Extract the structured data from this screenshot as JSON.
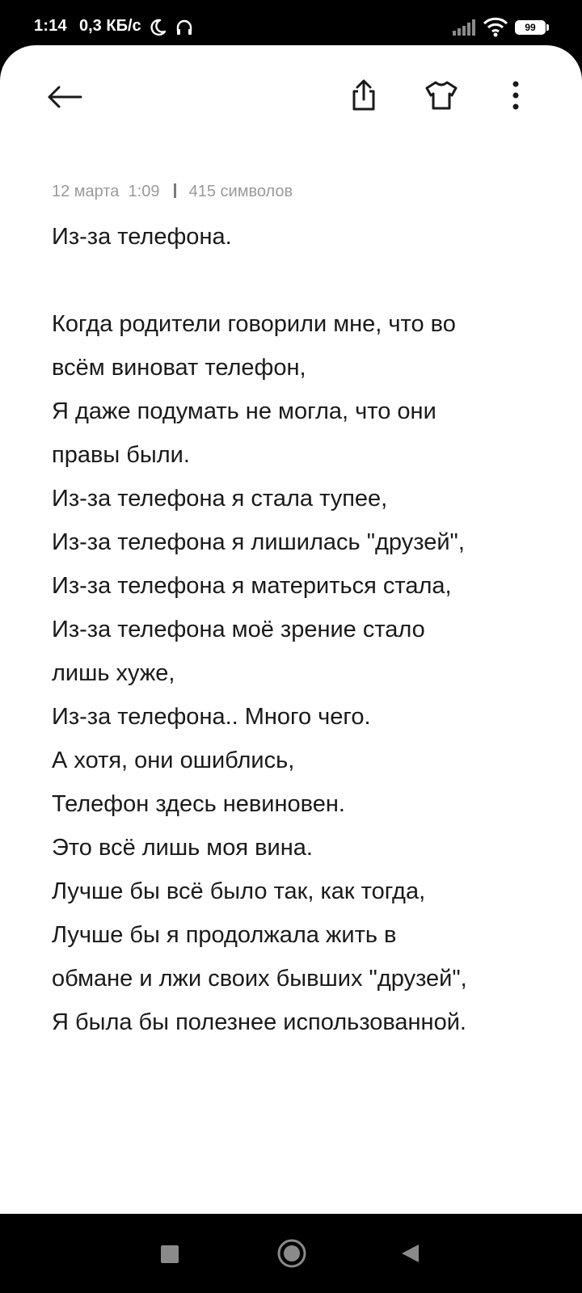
{
  "status_bar": {
    "time": "1:14",
    "speed": "0,3 КБ/с",
    "battery": "99",
    "icons": [
      "moon-icon",
      "headset-icon",
      "signal-icon",
      "wifi-icon",
      "battery-icon"
    ]
  },
  "toolbar": {
    "icons": [
      "back-arrow-icon",
      "share-icon",
      "tshirt-icon",
      "more-vertical-icon"
    ]
  },
  "note": {
    "date": "12 марта  1:09",
    "char_count": "415 символов",
    "lines": [
      "Из-за телефона.",
      "",
      "Когда родители говорили мне, что во",
      "всём виноват телефон,",
      "Я даже подумать не могла, что они",
      "правы были.",
      "Из-за телефона я стала тупее,",
      "Из-за телефона я лишилась \"друзей\",",
      "Из-за телефона я материться стала,",
      "Из-за телефона моё зрение стало",
      "лишь хуже,",
      "Из-за телефона.. Много чего.",
      "А хотя, они ошиблись,",
      "Телефон здесь невиновен.",
      "Это всё лишь моя вина.",
      "Лучше бы всё было так, как тогда,",
      "Лучше бы я продолжала жить в",
      "обмане и лжи своих бывших \"друзей\",",
      "Я была бы полезнее использованной."
    ]
  },
  "nav_bar": {
    "icons": [
      "recents-icon",
      "home-icon",
      "back-icon"
    ]
  },
  "colors": {
    "background": "#ffffff",
    "text": "#1a1a1a",
    "meta": "#9a9a9a",
    "system_bars": "#000000"
  }
}
